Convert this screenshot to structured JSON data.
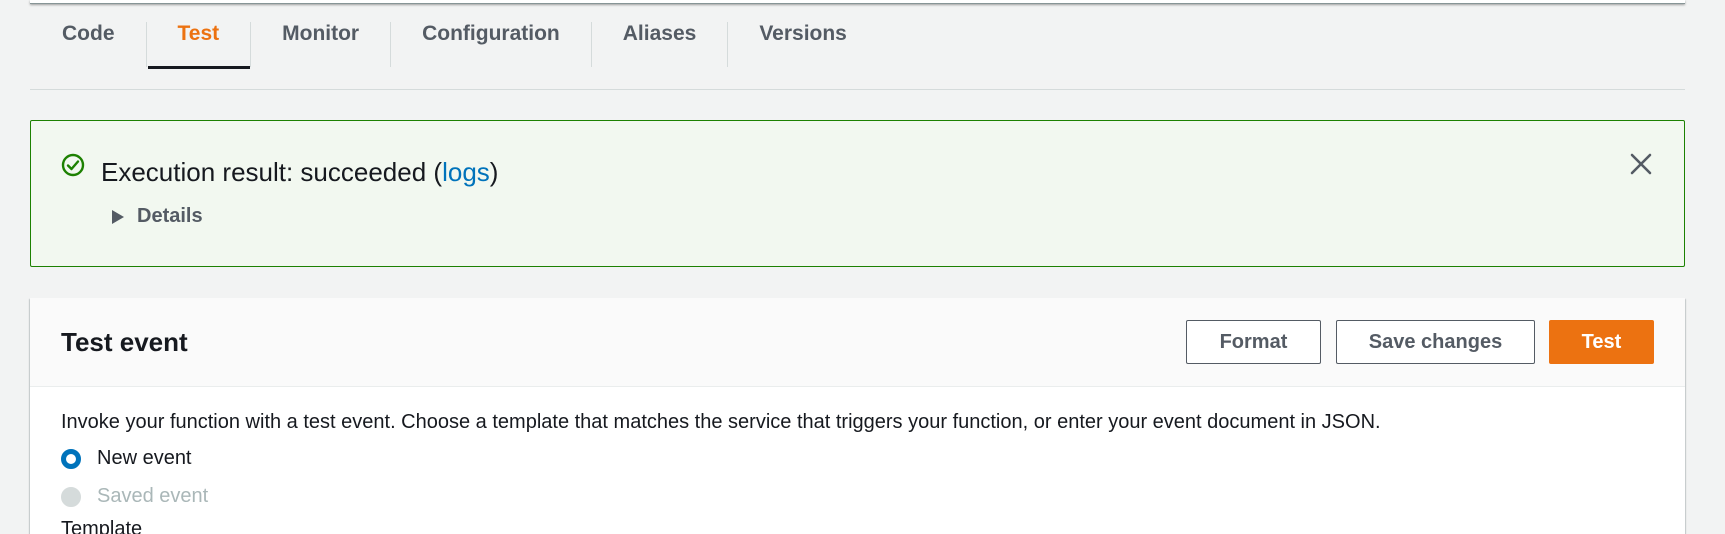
{
  "tabs": [
    {
      "label": "Code",
      "active": false
    },
    {
      "label": "Test",
      "active": true
    },
    {
      "label": "Monitor",
      "active": false
    },
    {
      "label": "Configuration",
      "active": false
    },
    {
      "label": "Aliases",
      "active": false
    },
    {
      "label": "Versions",
      "active": false
    }
  ],
  "alert": {
    "title_prefix": "Execution result: succeeded (",
    "link_text": "logs",
    "title_suffix": ")",
    "details_label": "Details",
    "icons": {
      "status": "check-circle-icon",
      "close": "close-icon",
      "expand": "caret-right-icon"
    }
  },
  "test_event": {
    "title": "Test event",
    "format_label": "Format",
    "save_label": "Save changes",
    "test_label": "Test",
    "description": "Invoke your function with a test event. Choose a template that matches the service that triggers your function, or enter your event document in JSON.",
    "options": [
      {
        "label": "New event",
        "selected": true,
        "disabled": false
      },
      {
        "label": "Saved event",
        "selected": false,
        "disabled": true
      }
    ],
    "template_label": "Template"
  },
  "colors": {
    "accent": "#ec7211",
    "link": "#0073bb",
    "success": "#1d8102",
    "success_bg": "#f2f8f0",
    "text": "#16191f",
    "muted": "#545b64"
  }
}
